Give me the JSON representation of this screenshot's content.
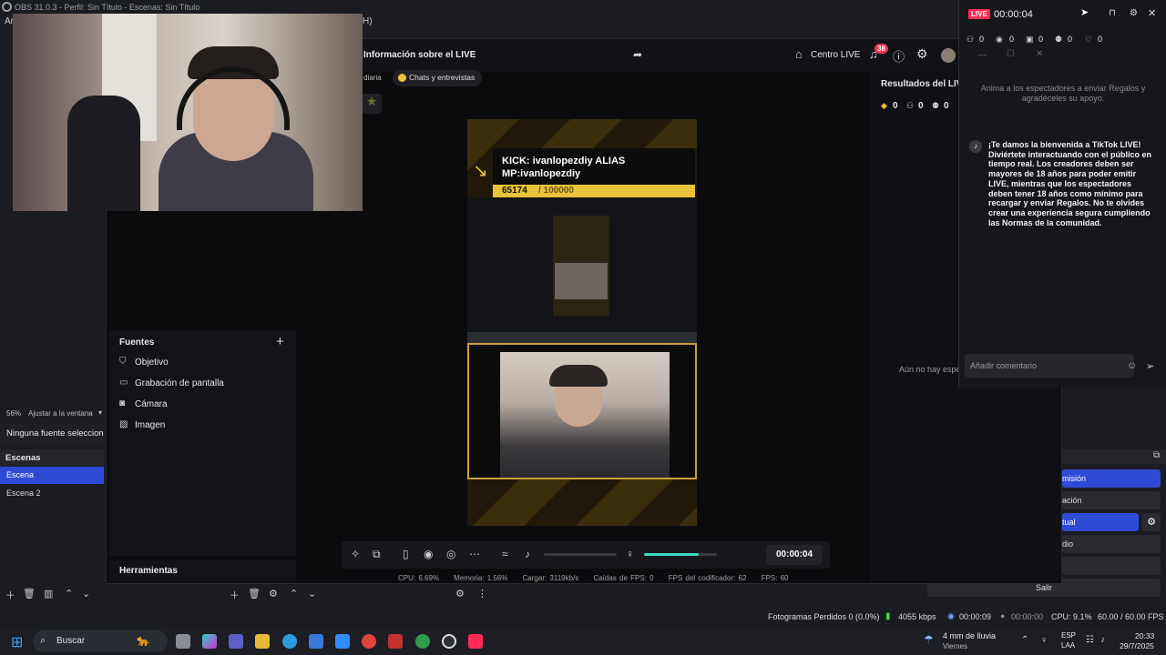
{
  "obs": {
    "titlebar": "OBS 31.0.3 - Perfil: Sin Título - Escenas: Sin Título",
    "menu_fragment": "Ar",
    "menu_fragment_right": "H)",
    "zoom_label": "56%",
    "fit_label": "Ajustar a la ventana",
    "no_source": "Ninguna fuente seleccionada",
    "scenes_title": "Escenas",
    "scenes": [
      "Escena",
      "Escena 2"
    ],
    "controls": [
      "misión",
      "ación",
      "tual",
      "dio",
      "Salir"
    ],
    "status": {
      "dropped": "Fotogramas Perdidos 0 (0.0%)",
      "bitrate": "4055 kbps",
      "rec_time": "00:00:09",
      "stream_time": "00:00:00",
      "cpu": "CPU: 9.1%",
      "fps": "60.00 / 60.00 FPS"
    }
  },
  "tiktok": {
    "header_title": "Información sobre el LIVE",
    "centro_live": "Centro LIVE",
    "notif_count": "38",
    "chip_left": "diaria",
    "chip_chats": "Chats y entrevistas",
    "preview": {
      "kick_text": "KICK: ivanlopezdiy ALIAS\nMP:ivanlopezdiy",
      "goal_current": "65174",
      "goal_target": "/ 100000"
    },
    "time": "00:00:04",
    "stats": {
      "cpu": "CPU:  6.69%",
      "memoria": "Memoria:  1.56%",
      "cargar": "Cargar:  3119kb/s",
      "caidas": "Caídas de FPS:  0",
      "fps_cod": "FPS del codificador:  62",
      "fps": "FPS:  60"
    },
    "fuentes_title": "Fuentes",
    "fuentes": [
      "Objetivo",
      "Grabación de pantalla",
      "Cámara",
      "Imagen"
    ],
    "herramientas": "Herramientas",
    "results_title": "Resultados del LIVE",
    "results_counts": [
      "0",
      "0",
      "0",
      "0"
    ],
    "no_viewers": "Aún no hay espectadores en directo"
  },
  "overlay": {
    "live_label": "LIVE",
    "timer": "00:00:04",
    "counts": [
      "0",
      "0",
      "0",
      "0",
      "0"
    ],
    "gift_prompt": "Anima a los espectadores a enviar Regalos y agradéceles su apoyo.",
    "welcome": "¡Te damos la bienvenida a TikTok LIVE! Diviértete interactuando con el público en tiempo real. Los creadores deben ser mayores de 18 años para poder emitir LIVE, mientras que los espectadores deben tener 18 años como mínimo para recargar y enviar Regalos. No te olvides crear una experiencia segura cumpliendo las Normas de la comunidad.",
    "comment_placeholder": "Añadir comentario"
  },
  "taskbar": {
    "search": "Buscar",
    "weather": "4 mm de lluvia",
    "weather_day": "Viernes",
    "lang": "ESP",
    "lang2": "LAA",
    "time": "20:33",
    "date": "29/7/2025"
  },
  "colors": {
    "accent_blue": "#2f4bd6",
    "tiktok_red": "#fe2c55",
    "gold": "#e8c23a"
  }
}
